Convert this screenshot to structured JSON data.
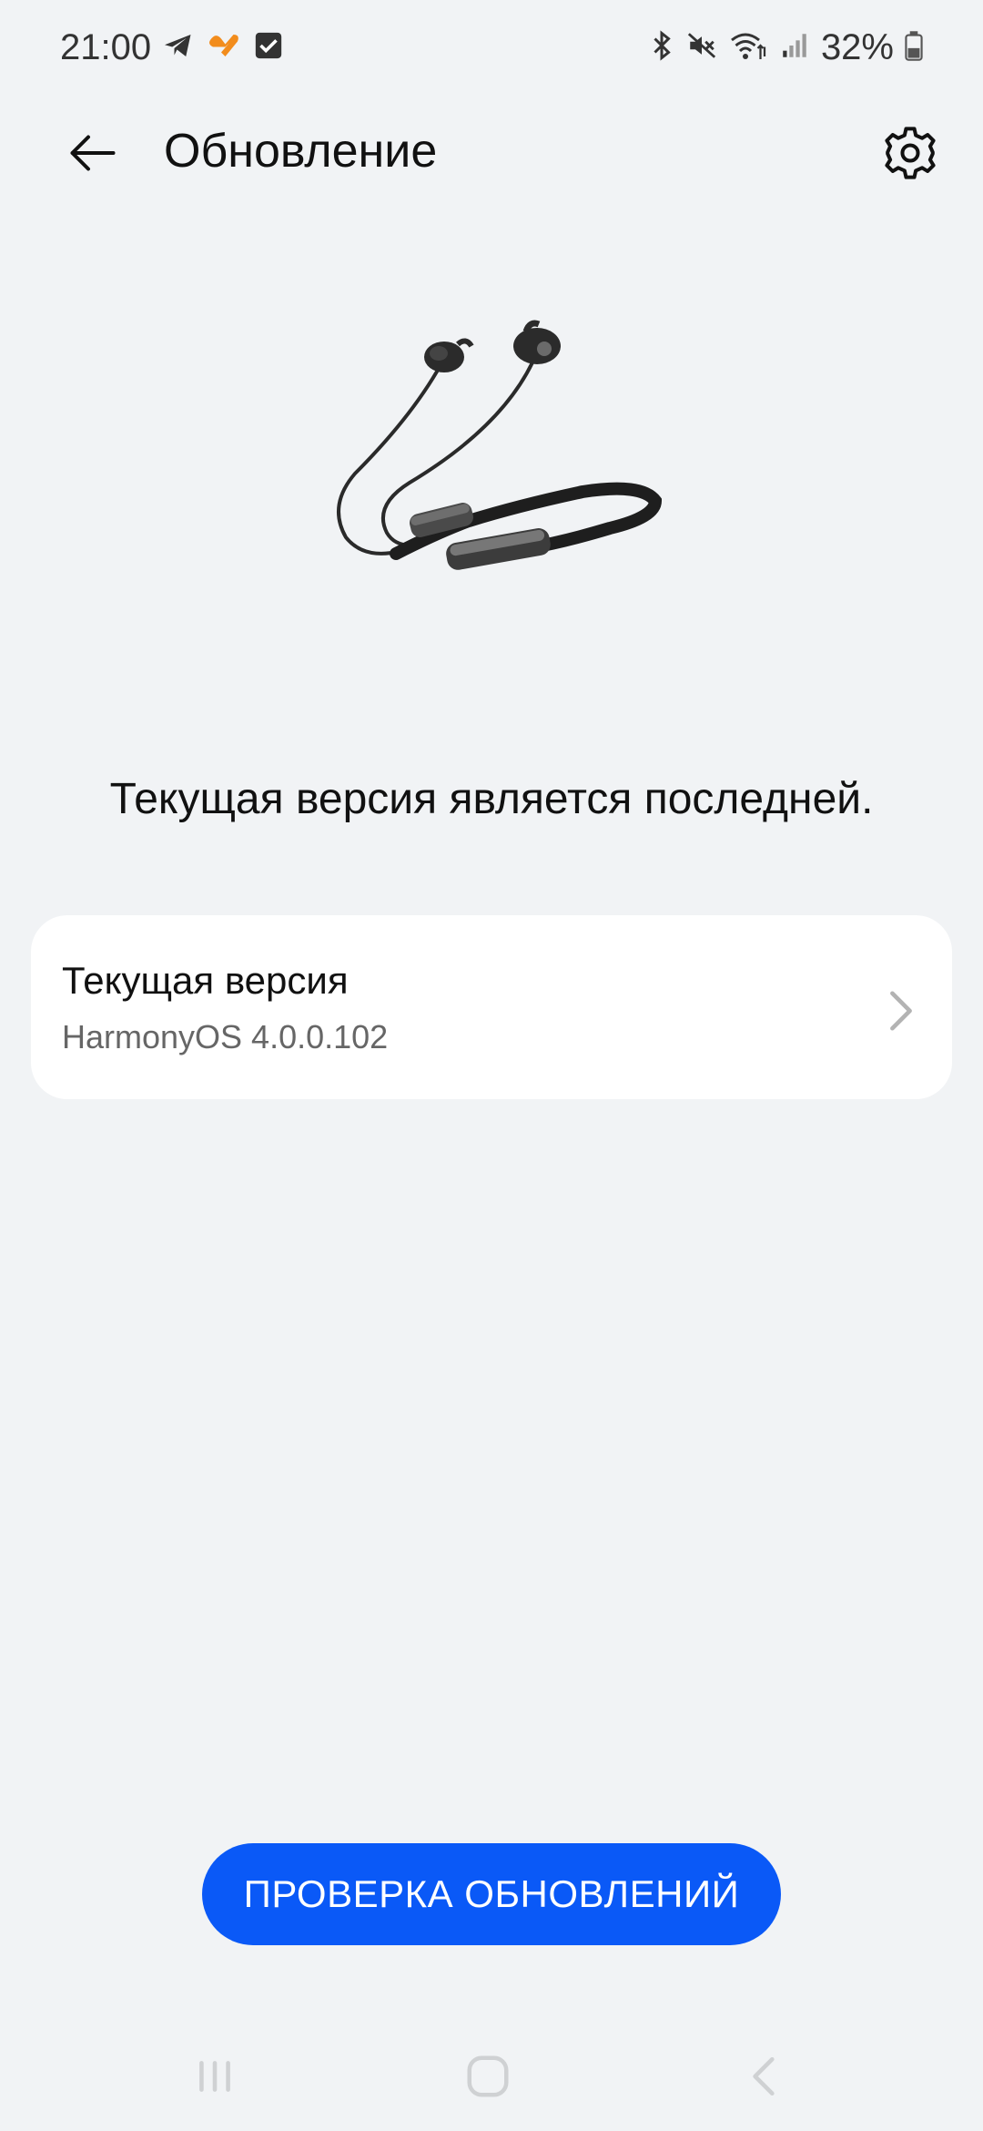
{
  "status_bar": {
    "time": "21:00",
    "battery": "32%",
    "left_icons": [
      "telegram-icon",
      "app-heart-icon",
      "checkbox-icon"
    ],
    "right_icons": [
      "bluetooth-icon",
      "mute-icon",
      "wifi-icon",
      "signal-icon",
      "battery-icon"
    ]
  },
  "header": {
    "title": "Обновление",
    "back_icon": "arrow-left-icon",
    "settings_icon": "gear-icon"
  },
  "product": {
    "image": "neckband-earphones"
  },
  "status_message": "Текущая версия является последней.",
  "version_card": {
    "label": "Текущая версия",
    "value": "HarmonyOS 4.0.0.102",
    "chevron_icon": "chevron-right-icon"
  },
  "check_button": {
    "label": "ПРОВЕРКА ОБНОВЛЕНИЙ"
  },
  "colors": {
    "background": "#f1f3f5",
    "card": "#ffffff",
    "accent": "#0a59f7",
    "primary_text": "#111111",
    "secondary_text": "#666666"
  },
  "nav_bar": {
    "icons": [
      "recents-icon",
      "home-icon",
      "back-icon"
    ]
  }
}
